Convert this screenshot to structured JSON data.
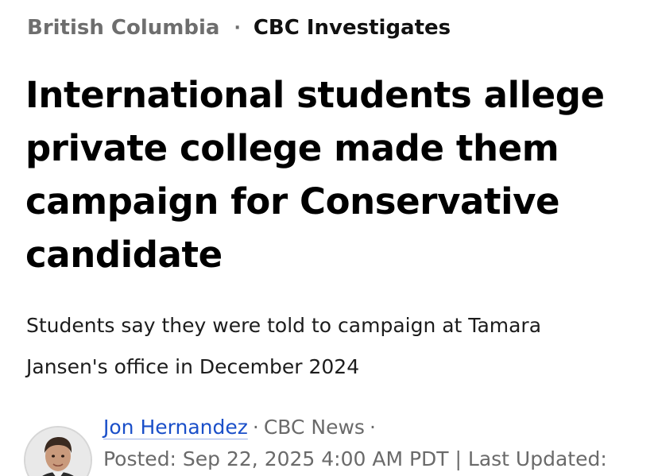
{
  "breadcrumb": {
    "section": "British Columbia",
    "separator": "·",
    "series": "CBC Investigates"
  },
  "article": {
    "headline_lines": [
      "International students allege",
      "private college made them",
      "campaign for Conservative",
      "candidate"
    ],
    "deck_lines": [
      "Students say they were told to campaign at Tamara",
      "Jansen's office in December 2024"
    ]
  },
  "byline": {
    "author": "Jon Hernandez",
    "separator": "·",
    "outlet": "CBC News",
    "trailing_separator": "·",
    "posted": "Posted: Sep 22, 2025 4:00 AM PDT | Last Updated:"
  },
  "colors": {
    "link": "#1a4fc9",
    "meta_text": "#6a6a6a",
    "section_text": "#6e6e6e"
  },
  "icons": {
    "avatar": "author-photo"
  }
}
